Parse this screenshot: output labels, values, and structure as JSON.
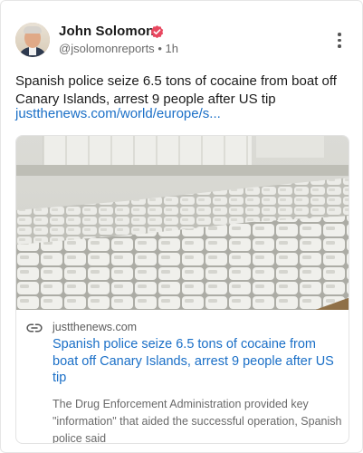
{
  "author": {
    "name": "John Solomon",
    "handle": "@jsolomonreports",
    "time": "1h",
    "separator": "•"
  },
  "post": {
    "text": "Spanish police seize 6.5 tons of cocaine from boat off Canary Islands, arrest 9 people after US tip",
    "link_text": "justthenews.com/world/europe/s..."
  },
  "link_card": {
    "domain": "justthenews.com",
    "title": "Spanish police seize 6.5 tons of cocaine from boat off Canary Islands, arrest 9 people after US tip",
    "description": "The Drug Enforcement Administration provided key \"information\" that aided the successful operation, Spanish police said"
  },
  "icons": {
    "verified": "verified-badge-icon",
    "more": "more-vertical-icon",
    "link": "link-icon"
  },
  "colors": {
    "link": "#1a6fc7",
    "verified_badge": "#e8475f",
    "muted_text": "#6a6a6a"
  }
}
